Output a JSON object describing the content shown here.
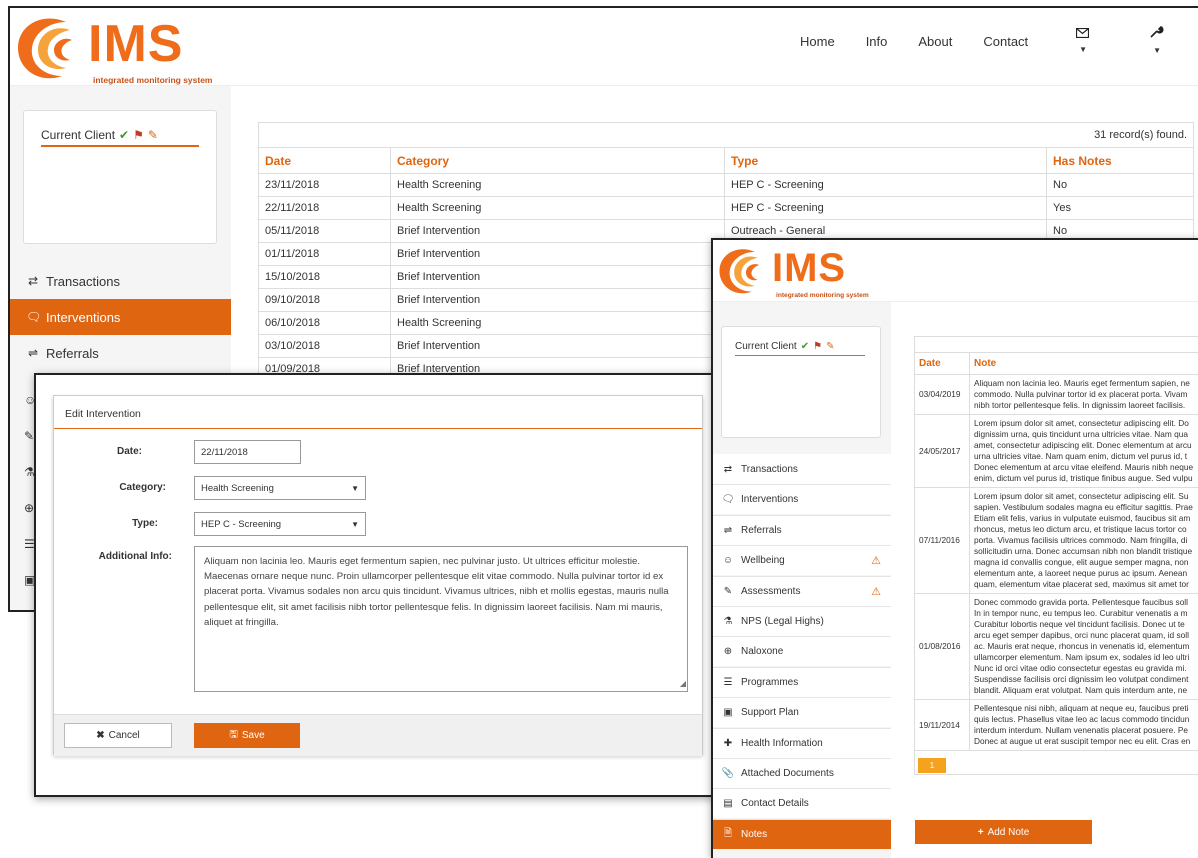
{
  "brand": {
    "name": "IMS",
    "tagline": "integrated monitoring system"
  },
  "nav": {
    "home": "Home",
    "info": "Info",
    "about": "About",
    "contact": "Contact"
  },
  "client": {
    "label": "Current Client"
  },
  "sidebar1": {
    "items": [
      "Transactions",
      "Interventions",
      "Referrals"
    ]
  },
  "interventions": {
    "count_text": "31 record(s) found.",
    "headers": [
      "Date",
      "Category",
      "Type",
      "Has Notes"
    ],
    "rows": [
      [
        "23/11/2018",
        "Health Screening",
        "HEP C - Screening",
        "No"
      ],
      [
        "22/11/2018",
        "Health Screening",
        "HEP C - Screening",
        "Yes"
      ],
      [
        "05/11/2018",
        "Brief Intervention",
        "Outreach - General",
        "No"
      ],
      [
        "01/11/2018",
        "Brief Intervention",
        "",
        ""
      ],
      [
        "15/10/2018",
        "Brief Intervention",
        "",
        ""
      ],
      [
        "09/10/2018",
        "Brief Intervention",
        "",
        ""
      ],
      [
        "06/10/2018",
        "Health Screening",
        "",
        ""
      ],
      [
        "03/10/2018",
        "Brief Intervention",
        "",
        ""
      ],
      [
        "01/09/2018",
        "Brief Intervention",
        "",
        ""
      ]
    ]
  },
  "edit_form": {
    "title": "Edit Intervention",
    "date_label": "Date:",
    "date_value": "22/11/2018",
    "category_label": "Category:",
    "category_value": "Health Screening",
    "type_label": "Type:",
    "type_value": "HEP C - Screening",
    "info_label": "Additional Info:",
    "info_value": "Aliquam non lacinia leo. Mauris eget fermentum sapien, nec pulvinar justo. Ut ultrices efficitur molestie. Maecenas ornare neque nunc. Proin ullamcorper pellentesque elit vitae commodo. Nulla pulvinar tortor id ex placerat porta. Vivamus sodales non arcu quis tincidunt. Vivamus ultrices, nibh et mollis egestas, mauris nulla pellentesque elit, sit amet facilisis nibh tortor pellentesque felis. In dignissim laoreet facilisis. Nam mi mauris, aliquet at fringilla.",
    "cancel": "Cancel",
    "save": "Save"
  },
  "sidebar2": {
    "items": [
      "Transactions",
      "Interventions",
      "Referrals",
      "Wellbeing",
      "Assessments",
      "NPS (Legal Highs)",
      "Naloxone",
      "Programmes",
      "Support Plan",
      "Health Information",
      "Attached Documents",
      "Contact Details",
      "Notes"
    ]
  },
  "notes": {
    "headers": [
      "Date",
      "Note"
    ],
    "rows": [
      {
        "date": "03/04/2019",
        "lines": [
          "Aliquam non lacinia leo. Mauris eget fermentum sapien, ne",
          "commodo. Nulla pulvinar tortor id ex placerat porta. Vivam",
          "nibh tortor pellentesque felis. In dignissim laoreet facilisis."
        ]
      },
      {
        "date": "24/05/2017",
        "lines": [
          "Lorem ipsum dolor sit amet, consectetur adipiscing elit. Do",
          "dignissim urna, quis tincidunt urna ultricies vitae. Nam qua",
          "amet, consectetur adipiscing elit. Donec elementum at arcu",
          "urna ultricies vitae. Nam quam enim, dictum vel purus id, t",
          "Donec elementum at arcu vitae eleifend. Mauris nibh neque",
          "enim, dictum vel purus id, tristique finibus augue. Sed vulpu"
        ]
      },
      {
        "date": "07/11/2016",
        "lines": [
          "Lorem ipsum dolor sit amet, consectetur adipiscing elit. Su",
          "sapien. Vestibulum sodales magna eu efficitur sagittis. Prae",
          "Etiam elit felis, varius in vulputate euismod, faucibus sit am",
          "rhoncus, metus leo dictum arcu, et tristique lacus tortor co",
          "porta. Vivamus facilisis ultrices commodo. Nam fringilla, di",
          "sollicitudin urna. Donec accumsan nibh non blandit tristique",
          "magna id convallis congue, elit augue semper magna, non",
          "elementum ante, a laoreet neque purus ac ipsum. Aenean",
          "quam, elementum vitae placerat sed, maximus sit amet tor"
        ]
      },
      {
        "date": "01/08/2016",
        "lines": [
          "Donec commodo gravida porta. Pellentesque faucibus soll",
          "In in tempor nunc, eu tempus leo. Curabitur venenatis a m",
          "Curabitur lobortis neque vel tincidunt facilisis. Donec ut te",
          "arcu eget semper dapibus, orci nunc placerat quam, id soll",
          "ac. Mauris erat neque, rhoncus in venenatis id, elementum",
          "ullamcorper elementum. Nam ipsum ex, sodales id leo ultri",
          "Nunc id orci vitae odio consectetur egestas eu gravida mi.",
          "Suspendisse facilisis orci dignissim leo volutpat condiment",
          "blandit. Aliquam erat volutpat. Nam quis interdum ante, ne"
        ]
      },
      {
        "date": "19/11/2014",
        "lines": [
          "Pellentesque nisi nibh, aliquam at neque eu, faucibus preti",
          "quis lectus. Phasellus vitae leo ac lacus commodo tincidun",
          "interdum interdum. Nullam venenatis placerat posuere. Pe",
          "Donec at augue ut erat suscipit tempor nec eu elit. Cras en"
        ]
      }
    ],
    "page": "1",
    "add_button": "Add Note"
  },
  "colors": {
    "accent": "#e0650f",
    "brand": "#ef6c1b",
    "success": "#3d9a2b",
    "warning": "#e0650f"
  }
}
